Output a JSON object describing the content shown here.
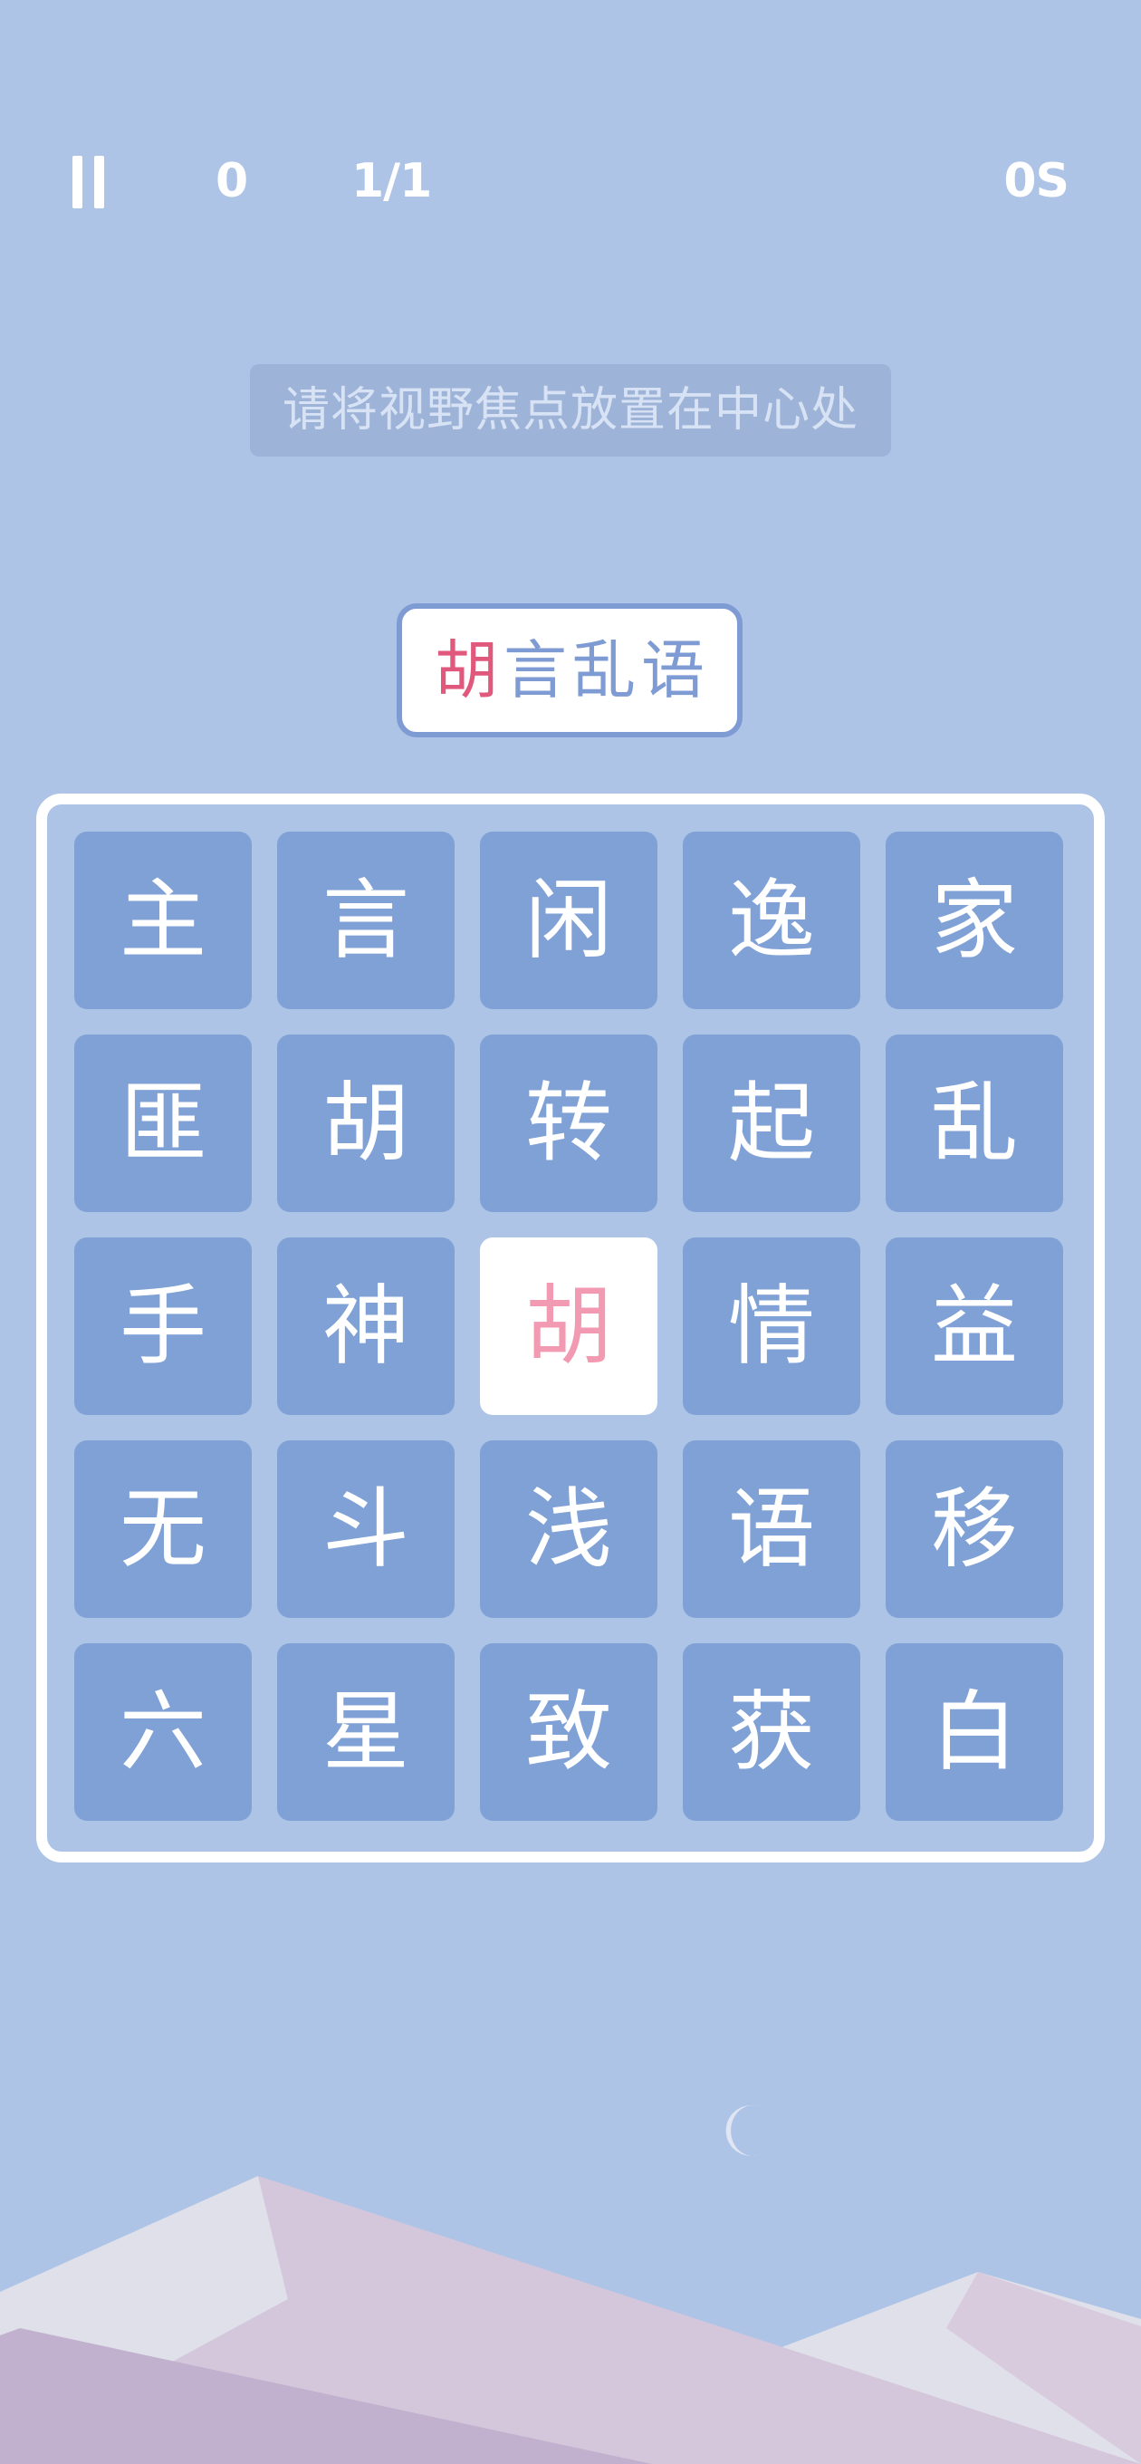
{
  "hud": {
    "score": "0",
    "progress": "1/1",
    "timer": "0S"
  },
  "hint": "请将视野焦点放置在中心处",
  "target": {
    "chars": [
      "胡",
      "言",
      "乱",
      "语"
    ],
    "highlight_index": 0,
    "highlight_color": "#e0587c"
  },
  "board": {
    "rows": 5,
    "cols": 5,
    "tiles": [
      "主",
      "言",
      "闲",
      "逸",
      "家",
      "匪",
      "胡",
      "转",
      "起",
      "乱",
      "手",
      "神",
      "胡",
      "情",
      "益",
      "无",
      "斗",
      "浅",
      "语",
      "移",
      "六",
      "星",
      "致",
      "获",
      "白"
    ],
    "active_index": 12
  },
  "colors": {
    "background": "#adc4e7",
    "tile": "#80a1d6",
    "tile_active_bg": "#ffffff",
    "tile_active_text": "#f19ab1"
  },
  "icons": {
    "pause": "pause-icon",
    "moon": "moon-icon"
  }
}
